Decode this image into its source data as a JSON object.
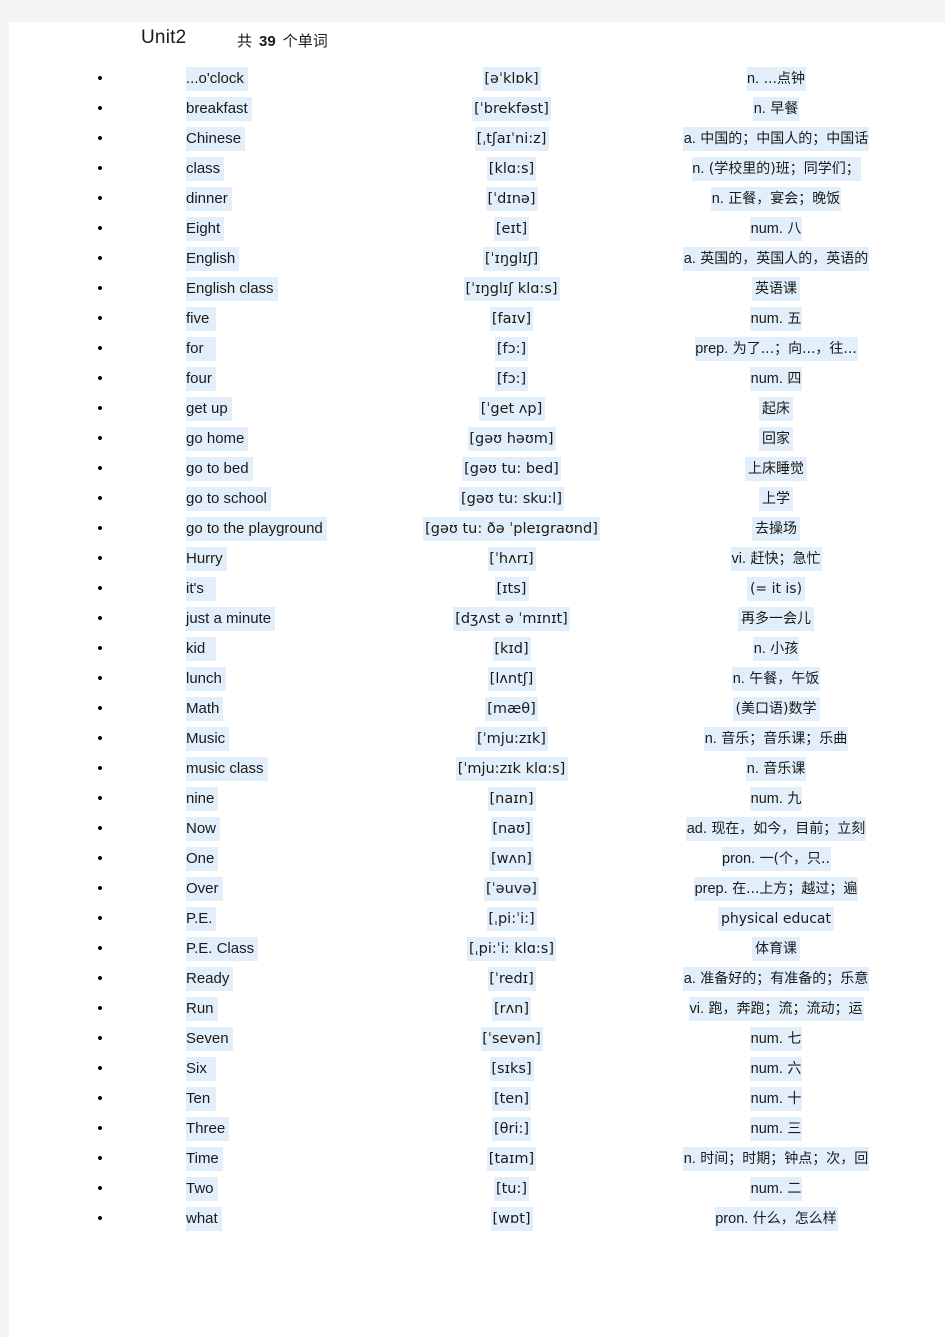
{
  "header": {
    "unit_title": "Unit2",
    "count_prefix": "共",
    "count_number": "39",
    "count_suffix": "个单词"
  },
  "colors": {
    "page_background": "#ffffff",
    "canvas_background": "#f4f4f4",
    "row_highlight": "#e3eefb",
    "text": "#1a1a1a"
  },
  "list": {
    "bullet_glyph": "•",
    "columns": [
      "word",
      "phonetic",
      "definition"
    ],
    "rows": [
      {
        "word": "...o'clock",
        "phonetic": "[əˈklɒk]",
        "pos": "n.",
        "definition": "...点钟"
      },
      {
        "word": "breakfast",
        "phonetic": "[ˈbrekfəst]",
        "pos": "n.",
        "definition": "早餐"
      },
      {
        "word": "Chinese",
        "phonetic": "[ˌtʃaɪˈni:z]",
        "pos": "a.",
        "definition": "中国的；中国人的；中国话"
      },
      {
        "word": "class",
        "phonetic": "[klɑ:s]",
        "pos": "n.",
        "definition": "(学校里的)班；同学们；"
      },
      {
        "word": "dinner",
        "phonetic": "[ˈdɪnə]",
        "pos": "n.",
        "definition": "正餐，宴会；晚饭"
      },
      {
        "word": "Eight",
        "phonetic": "[eɪt]",
        "pos": "num.",
        "definition": "八"
      },
      {
        "word": "English",
        "phonetic": "[ˈɪŋglɪʃ]",
        "pos": "a.",
        "definition": "英国的，英国人的，英语的"
      },
      {
        "word": "English class",
        "phonetic": "[ˈɪŋglɪʃ klɑ:s]",
        "pos": "",
        "definition": "英语课"
      },
      {
        "word": "five",
        "phonetic": "[faɪv]",
        "pos": "num.",
        "definition": "五"
      },
      {
        "word": "for",
        "phonetic": "[fɔ:]",
        "pos": "prep.",
        "definition": "为了...；向...，往..."
      },
      {
        "word": "four",
        "phonetic": "[fɔ:]",
        "pos": "num.",
        "definition": "四"
      },
      {
        "word": "get up",
        "phonetic": "[ˈget ʌp]",
        "pos": "",
        "definition": "起床"
      },
      {
        "word": "go home",
        "phonetic": "[gəʊ həʊm]",
        "pos": "",
        "definition": "回家"
      },
      {
        "word": "go to bed",
        "phonetic": "[gəʊ tu: bed]",
        "pos": "",
        "definition": "上床睡觉"
      },
      {
        "word": "go to school",
        "phonetic": "[gəʊ tu: sku:l]",
        "pos": "",
        "definition": "上学"
      },
      {
        "word": "go to the playground",
        "phonetic": "[gəʊ tu: ðə ˈpleɪgraʊnd]",
        "pos": "",
        "definition": "去操场"
      },
      {
        "word": "Hurry",
        "phonetic": "[ˈhʌrɪ]",
        "pos": "vi.",
        "definition": "赶快；急忙"
      },
      {
        "word": "it's",
        "phonetic": "[ɪts]",
        "pos": "",
        "definition": "(= it is)"
      },
      {
        "word": "just a minute",
        "phonetic": "[dʒʌst ə ˈmɪnɪt]",
        "pos": "",
        "definition": "再多一会儿"
      },
      {
        "word": "kid",
        "phonetic": "[kɪd]",
        "pos": "n.",
        "definition": "小孩"
      },
      {
        "word": "lunch",
        "phonetic": "[lʌntʃ]",
        "pos": "n.",
        "definition": "午餐，午饭"
      },
      {
        "word": "Math",
        "phonetic": "[mæθ]",
        "pos": "",
        "definition": "(美口语)数学"
      },
      {
        "word": "Music",
        "phonetic": "[ˈmju:zɪk]",
        "pos": "n.",
        "definition": "音乐；音乐课；乐曲"
      },
      {
        "word": "music class",
        "phonetic": "[ˈmju:zɪk klɑ:s]",
        "pos": "n.",
        "definition": "音乐课"
      },
      {
        "word": "nine",
        "phonetic": "[naɪn]",
        "pos": "num.",
        "definition": "九"
      },
      {
        "word": "Now",
        "phonetic": "[naʊ]",
        "pos": "ad.",
        "definition": "现在，如今，目前；立刻"
      },
      {
        "word": "One",
        "phonetic": "[wʌn]",
        "pos": "pron.",
        "definition": "一(个，只.."
      },
      {
        "word": "Over",
        "phonetic": "[ˈəuvə]",
        "pos": "prep.",
        "definition": "在...上方；越过；遍"
      },
      {
        "word": "P.E.",
        "phonetic": "[ˌpi:ˈi:]",
        "pos": "",
        "definition": "physical educat"
      },
      {
        "word": "P.E. Class",
        "phonetic": "[ˌpi:ˈi: klɑ:s]",
        "pos": "",
        "definition": "体育课"
      },
      {
        "word": "Ready",
        "phonetic": "[ˈredɪ]",
        "pos": "a.",
        "definition": "准备好的；有准备的；乐意"
      },
      {
        "word": "Run",
        "phonetic": "[rʌn]",
        "pos": "vi.",
        "definition": "跑，奔跑；流；流动；运"
      },
      {
        "word": "Seven",
        "phonetic": "[ˈsevən]",
        "pos": "num.",
        "definition": "七"
      },
      {
        "word": "Six",
        "phonetic": "[sɪks]",
        "pos": "num.",
        "definition": "六"
      },
      {
        "word": "Ten",
        "phonetic": "[ten]",
        "pos": "num.",
        "definition": "十"
      },
      {
        "word": "Three",
        "phonetic": "[θri:]",
        "pos": "num.",
        "definition": "三"
      },
      {
        "word": "Time",
        "phonetic": "[taɪm]",
        "pos": "n.",
        "definition": "时间；时期；钟点；次，回"
      },
      {
        "word": "Two",
        "phonetic": "[tu:]",
        "pos": "num.",
        "definition": "二"
      },
      {
        "word": "what",
        "phonetic": "[wɒt]",
        "pos": "pron.",
        "definition": "什么，怎么样"
      }
    ]
  }
}
